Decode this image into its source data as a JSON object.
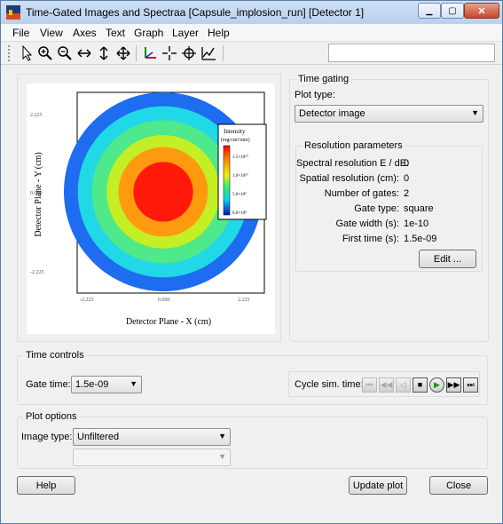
{
  "window": {
    "title": "Time-Gated Images and Spectraa [Capsule_implosion_run] [Detector 1]",
    "minimize_glyph": "▁",
    "maximize_glyph": "▢",
    "close_glyph": "✕"
  },
  "menubar": [
    "File",
    "View",
    "Axes",
    "Text",
    "Graph",
    "Layer",
    "Help"
  ],
  "toolbar": {
    "icons": [
      "pointer-icon",
      "zoom-in-icon",
      "zoom-out-icon",
      "pan-horizontal-icon",
      "pan-vertical-icon",
      "pan-both-icon",
      "axes-icon",
      "crosshair-icon",
      "data-reader-icon",
      "plot-icon"
    ],
    "search_value": ""
  },
  "plot": {
    "xlabel": "Detector Plane - X (cm)",
    "ylabel": "Detector Plane - Y (cm)",
    "x_ticks": [
      "-2.225",
      "0.000",
      "2.225"
    ],
    "y_ticks": [
      "2.225",
      "0.000",
      "-2.225"
    ],
    "legend": {
      "title_line1": "Intensity",
      "title_line2": "(erg/cm²/ster)",
      "ticks": [
        "1.5×10¹⁰",
        "1.0×10¹⁰",
        "5.0×10⁹",
        "0.0×10⁰"
      ]
    },
    "rings": [
      {
        "level": 1.0,
        "color": "#1e6cf0"
      },
      {
        "level": 0.86,
        "color": "#20d8e6"
      },
      {
        "level": 0.72,
        "color": "#4fe88a"
      },
      {
        "level": 0.57,
        "color": "#c4ef24"
      },
      {
        "level": 0.45,
        "color": "#ff9a10"
      },
      {
        "level": 0.3,
        "color": "#ff1a0a"
      }
    ]
  },
  "time_gating": {
    "title": "Time gating",
    "plot_type_label": "Plot type:",
    "plot_type_value": "Detector image",
    "resolution": {
      "title": "Resolution parameters",
      "rows": [
        {
          "label": "Spectral resolution E / dE:",
          "value": "0"
        },
        {
          "label": "Spatial resolution (cm):",
          "value": "0"
        },
        {
          "label": "Number of gates:",
          "value": "2"
        },
        {
          "label": "Gate type:",
          "value": "square"
        },
        {
          "label": "Gate width (s):",
          "value": "1e-10"
        },
        {
          "label": "First time (s):",
          "value": "1.5e-09"
        }
      ],
      "edit_label": "Edit ..."
    }
  },
  "time_controls": {
    "title": "Time controls",
    "gate_time_label": "Gate time:",
    "gate_time_value": "1.5e-09",
    "cycle_label": "Cycle sim. time:",
    "cycle_buttons": [
      "⏮",
      "◀◀",
      "◁",
      "■",
      "▶",
      "▶▶",
      "⏭"
    ]
  },
  "plot_options": {
    "title": "Plot options",
    "image_type_label": "Image type:",
    "image_type_value": "Unfiltered",
    "secondary_value": ""
  },
  "buttons": {
    "help": "Help",
    "update_plot": "Update plot",
    "close": "Close"
  }
}
